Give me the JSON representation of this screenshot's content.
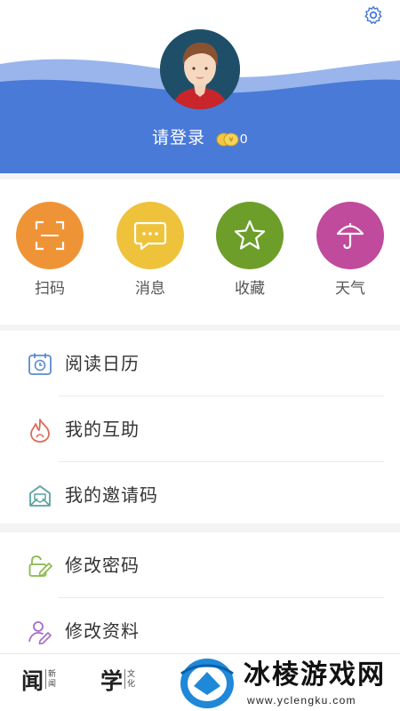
{
  "header": {
    "login_text": "请登录",
    "coin_count": "0",
    "colors": {
      "wave_dark": "#4a7ad8",
      "wave_light": "#9ab5ec"
    }
  },
  "quick_actions": [
    {
      "label": "扫码",
      "icon": "scan-icon",
      "color": "#ef9436"
    },
    {
      "label": "消息",
      "icon": "message-icon",
      "color": "#eec23a"
    },
    {
      "label": "收藏",
      "icon": "star-icon",
      "color": "#6d9e2a"
    },
    {
      "label": "天气",
      "icon": "umbrella-icon",
      "color": "#c04a9c"
    }
  ],
  "menu_group_1": [
    {
      "label": "阅读日历",
      "icon": "calendar-icon"
    },
    {
      "label": "我的互助",
      "icon": "flame-icon"
    },
    {
      "label": "我的邀请码",
      "icon": "envelope-icon"
    }
  ],
  "menu_group_2": [
    {
      "label": "修改密码",
      "icon": "edit-lock-icon"
    },
    {
      "label": "修改资料",
      "icon": "edit-profile-icon"
    }
  ],
  "tabbar": [
    {
      "big": "闻",
      "small": "新闻"
    },
    {
      "big": "学",
      "small": "文化"
    }
  ],
  "watermark": {
    "title": "冰棱游戏网",
    "url": "www.yclengku.com"
  }
}
